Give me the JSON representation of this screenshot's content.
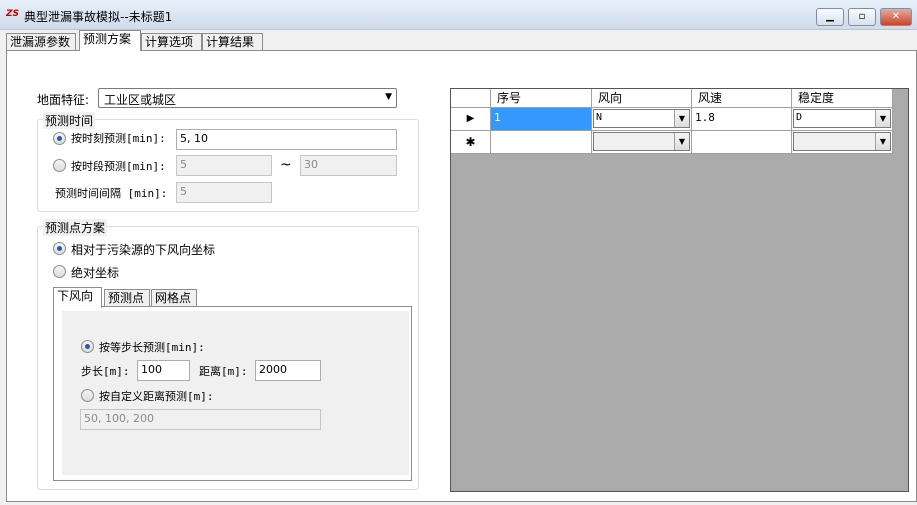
{
  "window": {
    "title": "典型泄漏事故模拟--未标题1",
    "app_icon": "app-logo-icon",
    "buttons": [
      "minimize",
      "maximize",
      "close"
    ]
  },
  "tabs": [
    "泄漏源参数",
    "预测方案",
    "计算选项",
    "计算结果"
  ],
  "surface": {
    "label": "地面特征:",
    "value": "工业区或城区"
  },
  "time": {
    "group_title": "预测时间",
    "moment_label": "按时刻预测[min]:",
    "moment_value": "5, 10",
    "period_label": "按时段预测[min]:",
    "period_from": "5",
    "period_sep": "~",
    "period_to": "30",
    "interval_label": "预测时间间隔 [min]:",
    "interval_value": "5"
  },
  "points": {
    "group_title": "预测点方案",
    "relative_label": "相对于污染源的下风向坐标",
    "absolute_label": "绝对坐标",
    "subtabs": [
      "下风向",
      "预测点",
      "网格点"
    ],
    "equal_step_label": "按等步长预测[min]:",
    "step_label": "步长[m]:",
    "step_value": "100",
    "distance_label": "距离[m]:",
    "distance_value": "2000",
    "custom_label": "按自定义距离预测[m]:",
    "custom_value": "50, 100, 200"
  },
  "grid": {
    "columns": [
      "序号",
      "风向",
      "风速",
      "稳定度"
    ],
    "rows": [
      {
        "marker": "▶",
        "no": "1",
        "dir": "N",
        "speed": "1.8",
        "stability": "D"
      },
      {
        "marker": "✱",
        "no": "",
        "dir": "",
        "speed": "",
        "stability": ""
      }
    ],
    "selection_color": "#3399ff"
  }
}
